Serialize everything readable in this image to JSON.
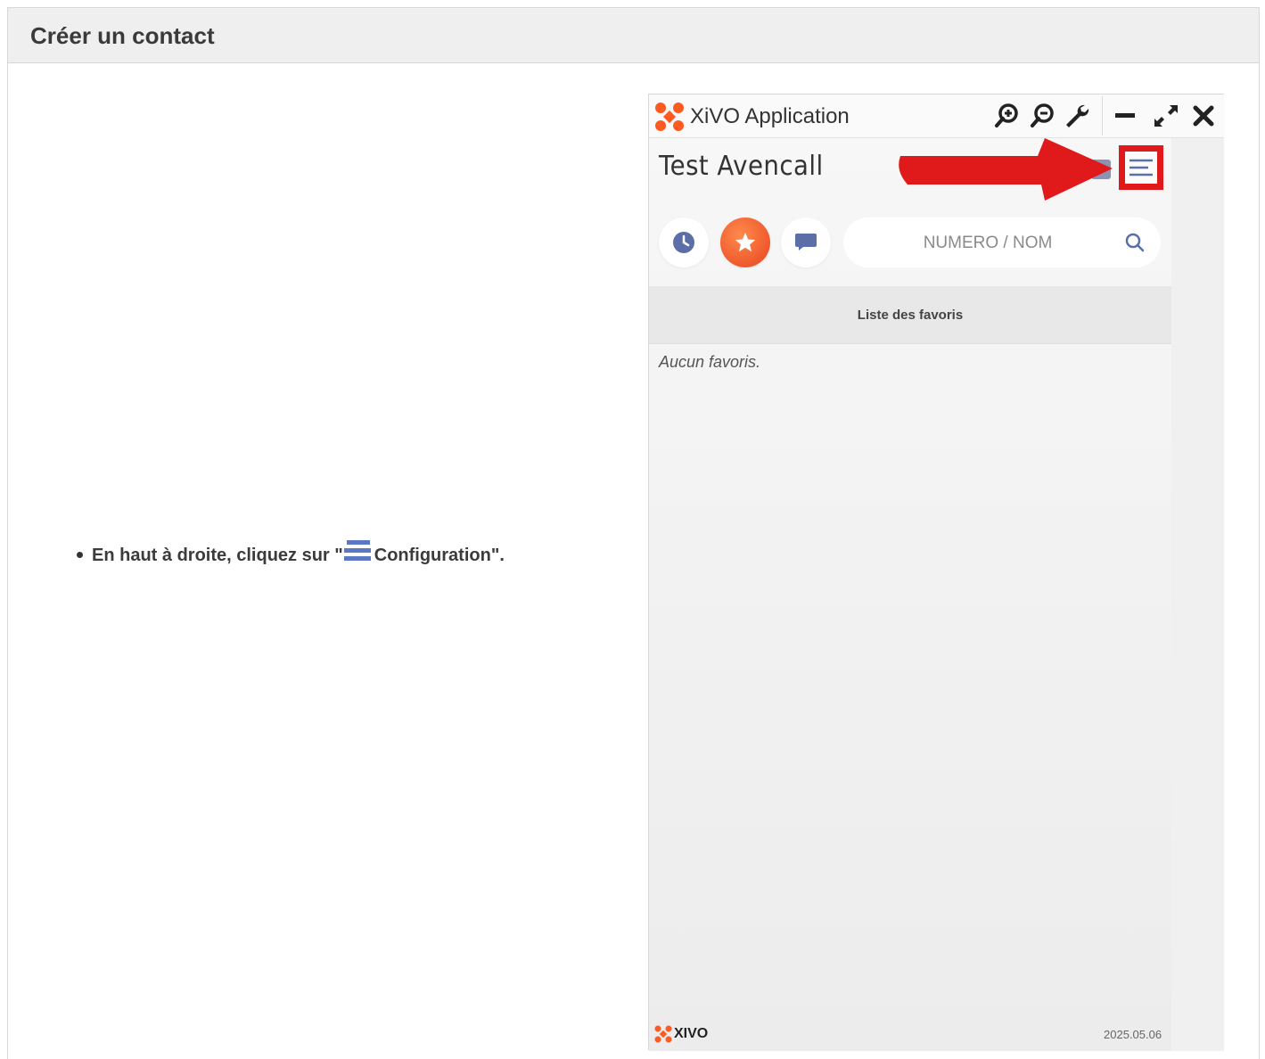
{
  "panel": {
    "title": "Créer un contact"
  },
  "instruction": {
    "prefix": "En haut à droite, cliquez sur \"",
    "suffix": "Configuration\"."
  },
  "window": {
    "title": "XiVO Application",
    "toolbar_icons": [
      "zoom-in-icon",
      "zoom-out-icon",
      "wrench-icon",
      "minimize-icon",
      "expand-icon",
      "close-icon"
    ]
  },
  "app": {
    "user_name": "Test Avencall",
    "tabs": [
      "history-icon",
      "favorites-star-icon",
      "chat-icon"
    ],
    "active_tab": "favorites-star-icon",
    "search": {
      "placeholder": "NUMERO / NOM"
    },
    "favorites_header": "Liste des favoris",
    "empty_message": "Aucun favoris.",
    "footer": {
      "brand": "XIVO",
      "version": "2025.05.06"
    }
  },
  "colors": {
    "accent_orange": "#ff5a1f",
    "highlight_red": "#e01a1a",
    "icon_blue": "#5b6ea8"
  }
}
